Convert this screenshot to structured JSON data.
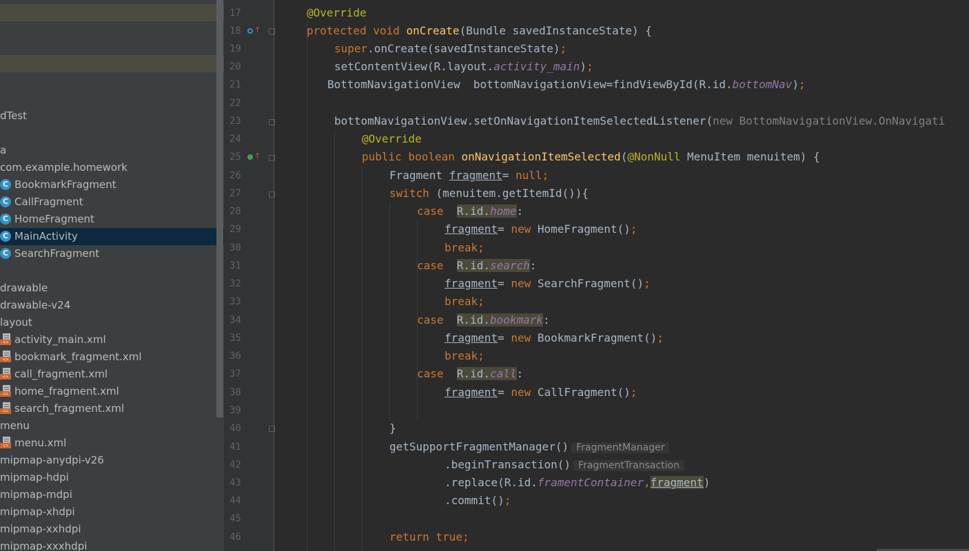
{
  "sidebar": {
    "items": [
      {
        "label": "",
        "indent": 0,
        "hl": true
      },
      {
        "label": "",
        "indent": 0,
        "hl": true
      },
      {
        "label": "dTest",
        "indent": 0
      },
      {
        "label": "a",
        "indent": 0
      },
      {
        "label": "com.example.homework",
        "indent": 0
      },
      {
        "label": "BookmarkFragment",
        "icon": "class-icon"
      },
      {
        "label": "CallFragment",
        "icon": "class-icon"
      },
      {
        "label": "HomeFragment",
        "icon": "class-icon"
      },
      {
        "label": "MainActivity",
        "icon": "class-icon",
        "selected": true
      },
      {
        "label": "SearchFragment",
        "icon": "class-icon"
      },
      {
        "label": "drawable"
      },
      {
        "label": "drawable-v24"
      },
      {
        "label": "layout"
      },
      {
        "label": "activity_main.xml",
        "icon": "xml-file-icon"
      },
      {
        "label": "bookmark_fragment.xml",
        "icon": "xml-file-icon"
      },
      {
        "label": "call_fragment.xml",
        "icon": "xml-file-icon"
      },
      {
        "label": "home_fragment.xml",
        "icon": "xml-file-icon"
      },
      {
        "label": "search_fragment.xml",
        "icon": "xml-file-icon"
      },
      {
        "label": "menu"
      },
      {
        "label": "menu.xml",
        "icon": "xml-file-icon"
      },
      {
        "label": "mipmap-anydpi-v26"
      },
      {
        "label": "mipmap-hdpi"
      },
      {
        "label": "mipmap-mdpi"
      },
      {
        "label": "mipmap-xhdpi"
      },
      {
        "label": "mipmap-xxhdpi"
      },
      {
        "label": "mipmap-xxxhdpi"
      }
    ],
    "class_icon_glyph": "C",
    "xml_icon_glyph": "<>"
  },
  "editor": {
    "colors": {
      "keyword": "#cc7832",
      "annotation": "#bbb529",
      "method": "#ffc66d",
      "field": "#9876aa",
      "default": "#a9b7c6"
    },
    "lines": [
      {
        "n": "17",
        "t": "@Override"
      },
      {
        "n": "18",
        "t": "protected void onCreate(Bundle savedInstanceState) {",
        "gutter": "override-icon"
      },
      {
        "n": "19",
        "t": "super.onCreate(savedInstanceState);"
      },
      {
        "n": "20",
        "t": "setContentView(R.layout.activity_main);"
      },
      {
        "n": "21",
        "t": "BottomNavigationView  bottomNavigationView=findViewById(R.id.bottomNav);"
      },
      {
        "n": "22",
        "t": ""
      },
      {
        "n": "23",
        "t": "bottomNavigationView.setOnNavigationItemSelectedListener(new BottomNavigationView.OnNavigati"
      },
      {
        "n": "24",
        "t": "@Override"
      },
      {
        "n": "25",
        "t": "public boolean onNavigationItemSelected(@NonNull MenuItem menuitem) {",
        "gutter": "implement-icon"
      },
      {
        "n": "26",
        "t": "Fragment fragment= null;"
      },
      {
        "n": "27",
        "t": "switch (menuitem.getItemId()){"
      },
      {
        "n": "28",
        "t": "case  R.id.home:"
      },
      {
        "n": "29",
        "t": "fragment= new HomeFragment();"
      },
      {
        "n": "30",
        "t": "break;"
      },
      {
        "n": "31",
        "t": "case  R.id.search:"
      },
      {
        "n": "32",
        "t": "fragment= new SearchFragment();"
      },
      {
        "n": "33",
        "t": "break;"
      },
      {
        "n": "34",
        "t": "case  R.id.bookmark:"
      },
      {
        "n": "35",
        "t": "fragment= new BookmarkFragment();"
      },
      {
        "n": "36",
        "t": "break;"
      },
      {
        "n": "37",
        "t": "case  R.id.call:"
      },
      {
        "n": "38",
        "t": "fragment= new CallFragment();"
      },
      {
        "n": "39",
        "t": ""
      },
      {
        "n": "40",
        "t": "}"
      },
      {
        "n": "41",
        "t": "getSupportFragmentManager()",
        "hint": "FragmentManager"
      },
      {
        "n": "42",
        "t": ".beginTransaction()",
        "hint": "FragmentTransaction"
      },
      {
        "n": "43",
        "t": ".replace(R.id.framentContainer,fragment)"
      },
      {
        "n": "44",
        "t": ".commit();"
      },
      {
        "n": "45",
        "t": ""
      },
      {
        "n": "46",
        "t": "return true;"
      }
    ]
  }
}
